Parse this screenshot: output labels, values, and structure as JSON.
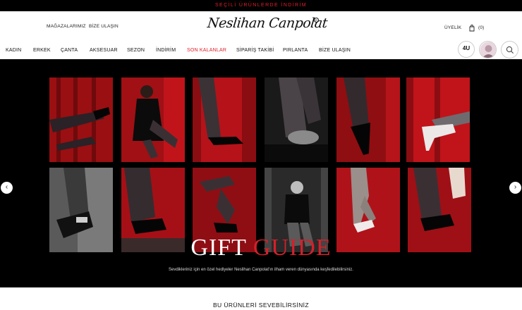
{
  "announcement": "SEÇİLİ ÜRÜNLERDE İNDİRİM",
  "top_links": {
    "stores": "MAĞAZALARIMIZ",
    "contact": "BİZE ULAŞIN"
  },
  "brand": "Neslihan Canpolat",
  "account": {
    "membership": "ÜYELİK",
    "cart_count": "(0)"
  },
  "nav": [
    "KADIN",
    "ERKEK",
    "ÇANTA",
    "AKSESUAR",
    "SEZON",
    "İNDİRİM",
    "SON KALANLAR",
    "SİPARİŞ TAKİBİ",
    "PIRLANTA",
    "BİZE ULAŞIN"
  ],
  "badge_4u": "4U",
  "hero": {
    "title_white": "GIFT",
    "title_red": "GUIDE",
    "subtitle": "Sevdikleriniz için en özel hediyeler Neslihan Canpolat'ın ilham veren dünyasında keşfedilebilirsiniz.",
    "prev": "‹",
    "next": "›"
  },
  "section_title": "BU ÜRÜNLERİ SEVEBİLİRSİNİZ",
  "colors": {
    "accent": "#e0202a",
    "hero_bg": "#000000"
  }
}
